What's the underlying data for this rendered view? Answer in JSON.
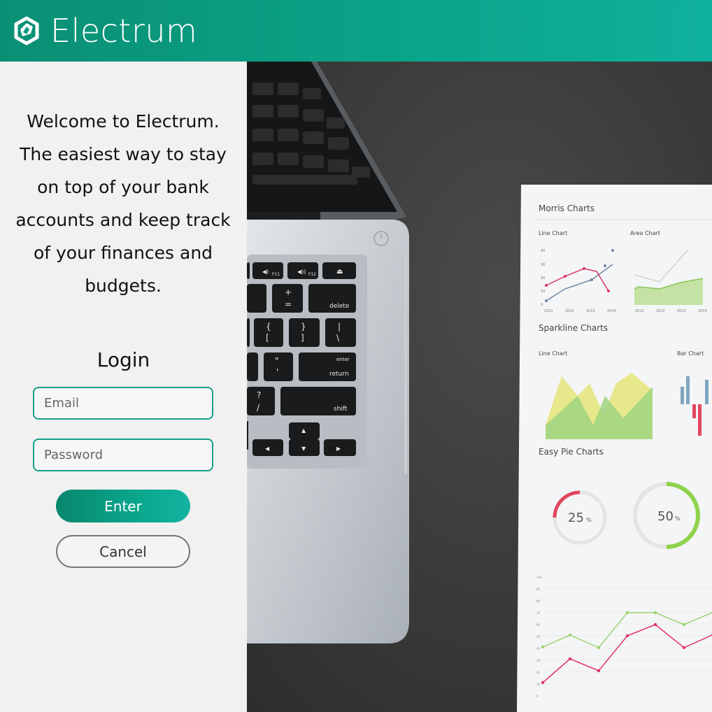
{
  "header": {
    "brand": "Electrum",
    "logo_icon": "electrum-logo-icon",
    "gradient_start": "#0a8f74",
    "gradient_end": "#0fb09d"
  },
  "welcome": {
    "lines": [
      "Welcome to Electrum.",
      "The easiest way to stay",
      "on top of your bank",
      "accounts and keep track",
      "of your finances and",
      "budgets."
    ]
  },
  "login": {
    "title": "Login",
    "email_placeholder": "Email",
    "password_placeholder": "Password",
    "enter_label": "Enter",
    "cancel_label": "Cancel",
    "accent": "#16a08a"
  },
  "photo": {
    "keys": {
      "f11": "F11",
      "f12": "F12",
      "plus": "+",
      "equals": "=",
      "delete": "delete",
      "brace_open": "{",
      "bracket_open": "[",
      "brace_close": "}",
      "bracket_close": "]",
      "pipe": "|",
      "backslash": "\\",
      "quote": "\"",
      "apostrophe": "'",
      "enter": "enter",
      "return": "return",
      "question": "?",
      "slash": "/",
      "shift": "shift"
    },
    "paper": {
      "heading1": "Morris Charts",
      "line_chart": "Line Chart",
      "area_chart": "Area Chart",
      "years": [
        "2011",
        "2012",
        "2013",
        "2014"
      ],
      "y_ticks": [
        "40",
        "30",
        "20",
        "10",
        "0"
      ],
      "heading2": "Sparkline Charts",
      "spark_line": "Line Chart",
      "bar_chart": "Bar Chart",
      "heading3": "Easy Pie Charts",
      "pie1": "25",
      "pie2": "50",
      "percent": "%",
      "bottom_y_ticks": [
        "100",
        "90",
        "80",
        "70",
        "60",
        "50",
        "40",
        "30",
        "20",
        "10",
        "0"
      ]
    }
  }
}
